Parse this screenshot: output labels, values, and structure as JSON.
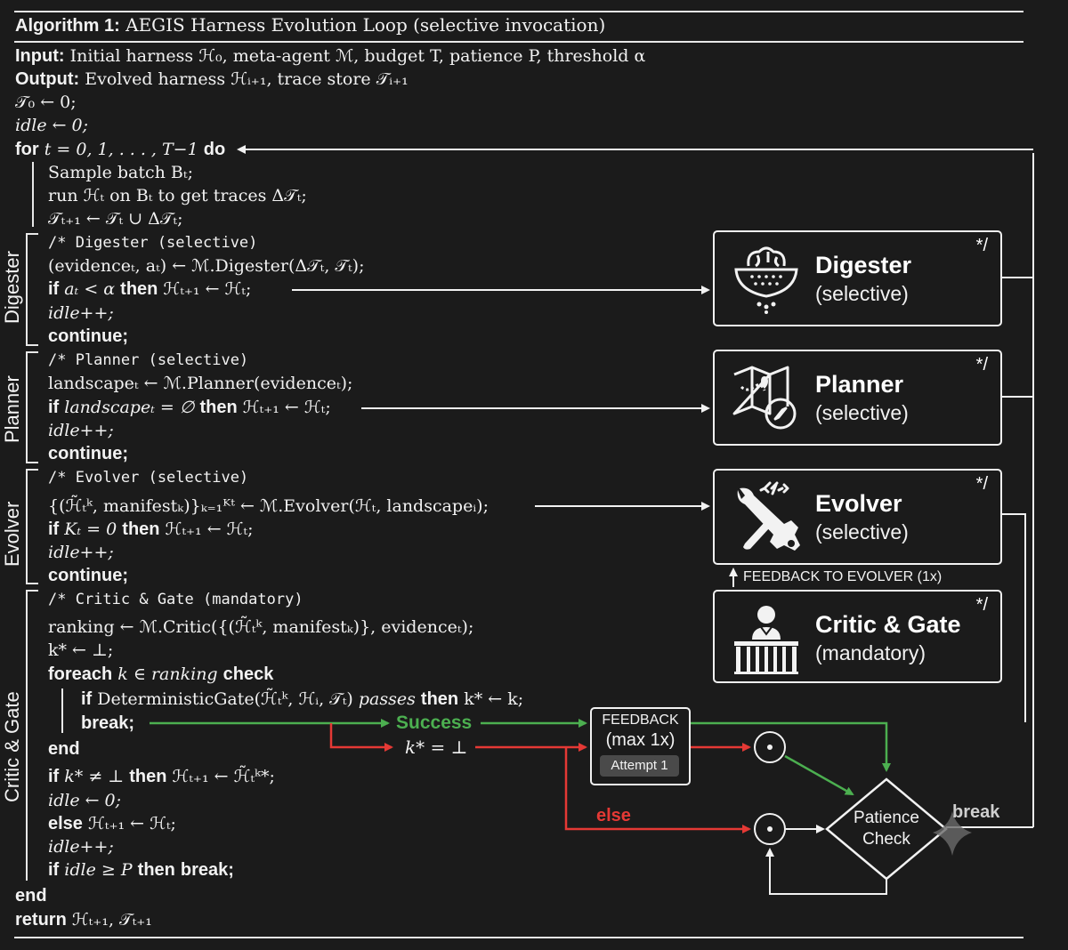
{
  "header": {
    "algo_label": "Algorithm 1:",
    "algo_title": "AEGIS Harness Evolution Loop (selective invocation)"
  },
  "io": {
    "input_label": "Input:",
    "input_text": "Initial harness ℋ₀, meta-agent ℳ, budget T, patience P, threshold α",
    "output_label": "Output:",
    "output_text": "Evolved harness ℋᵢ₊₁, trace store 𝒯ᵢ₊₁"
  },
  "init": {
    "line1": "𝒯₀ ← 0;",
    "line2": "idle ← 0;"
  },
  "loop": {
    "for_kw": "for",
    "for_range": "t = 0, 1, . . . , T−1",
    "do_kw": "do",
    "l1": "Sample batch Bₜ;",
    "l2": "run ℋₜ on Bₜ to get traces Δ𝒯ₜ;",
    "l3": "𝒯ₜ₊₁ ← 𝒯ₜ ∪ Δ𝒯ₜ;"
  },
  "digester": {
    "label": "Digester",
    "comment": "/* Digester (selective)",
    "call": "(evidenceₜ, aₜ) ← ℳ.Digester(Δ𝒯ₜ, 𝒯ₜ);",
    "if_kw": "if",
    "cond": "aₜ < α",
    "then_kw": "then",
    "assign": "ℋₜ₊₁ ← ℋₜ;",
    "idle": "idle++;",
    "continue_kw": "continue;"
  },
  "planner": {
    "label": "Planner",
    "comment": "/* Planner (selective)",
    "call": "landscapeₜ ← ℳ.Planner(evidenceₜ);",
    "if_kw": "if",
    "cond": "landscapeₜ = ∅",
    "then_kw": "then",
    "assign": "ℋₜ₊₁ ← ℋₜ;",
    "idle": "idle++;",
    "continue_kw": "continue;"
  },
  "evolver": {
    "label": "Evolver",
    "comment": "/* Evolver (selective)",
    "call": "{(ℋ̃ₜᵏ, manifestₖ)}ₖ₌₁ᴷᵗ ← ℳ.Evolver(ℋₜ, landscapeᵢ);",
    "if_kw": "if",
    "cond": "Kₜ = 0",
    "then_kw": "then",
    "assign": "ℋₜ₊₁ ← ℋₜ;",
    "idle": "idle++;",
    "continue_kw": "continue;"
  },
  "critic": {
    "label": "Critic & Gate",
    "comment": "/* Critic & Gate (mandatory)",
    "call": "ranking ← ℳ.Critic({(ℋ̃ₜᵏ, manifestₖ)}, evidenceₜ);",
    "kstar_init": "k* ← ⊥;",
    "foreach_kw": "foreach",
    "foreach_mid": "k ∈ ranking",
    "check_kw": "check",
    "gate_if": "if",
    "gate_cond": "DeterministicGate(ℋ̃ₜᵏ, ℋᵢ, 𝒯ₜ)",
    "gate_passes": "passes",
    "gate_then": "then",
    "gate_assign": "k* ← k;",
    "break_kw": "break;",
    "end_kw": "end",
    "if2_kw": "if",
    "if2_cond": "k* ≠ ⊥",
    "if2_then": "then",
    "if2_assign": "ℋₜ₊₁ ← ℋ̃ₜᵏ*;",
    "idle_reset": "idle ← 0;",
    "else_kw": "else",
    "else_assign": "ℋₜ₊₁ ← ℋₜ;",
    "idle_inc": "idle++;",
    "if3_kw": "if",
    "if3_cond": "idle ≥ P",
    "if3_then": "then",
    "if3_break": "break;"
  },
  "footer": {
    "end_kw": "end",
    "return_kw": "return",
    "return_val": "ℋₜ₊₁, 𝒯ₜ₊₁"
  },
  "boxes": {
    "digester": {
      "title": "Digester",
      "sub": "(selective)",
      "close": "*/",
      "icon": "brain-sieve-icon"
    },
    "planner": {
      "title": "Planner",
      "sub": "(selective)",
      "close": "*/",
      "icon": "map-compass-icon"
    },
    "evolver": {
      "title": "Evolver",
      "sub": "(selective)",
      "close": "*/",
      "icon": "wrench-code-icon"
    },
    "critic": {
      "title": "Critic & Gate",
      "sub": "(mandatory)",
      "close": "*/",
      "icon": "gatekeeper-icon"
    }
  },
  "flow": {
    "feedback_to_evolver": "FEEDBACK TO EVOLVER (1x)",
    "success": "Success",
    "kstar_bottom": "k* = ⊥",
    "else_label": "else",
    "feedback_title": "FEEDBACK",
    "feedback_max": "(max 1x)",
    "attempt": "Attempt 1",
    "patience_line1": "Patience",
    "patience_line2": "Check",
    "break_label": "break",
    "merge_symbol": "⊙"
  },
  "colors": {
    "background": "#1b1b1b",
    "foreground": "#f2f2f2",
    "success_green": "#4caf50",
    "fail_red": "#e53935"
  }
}
